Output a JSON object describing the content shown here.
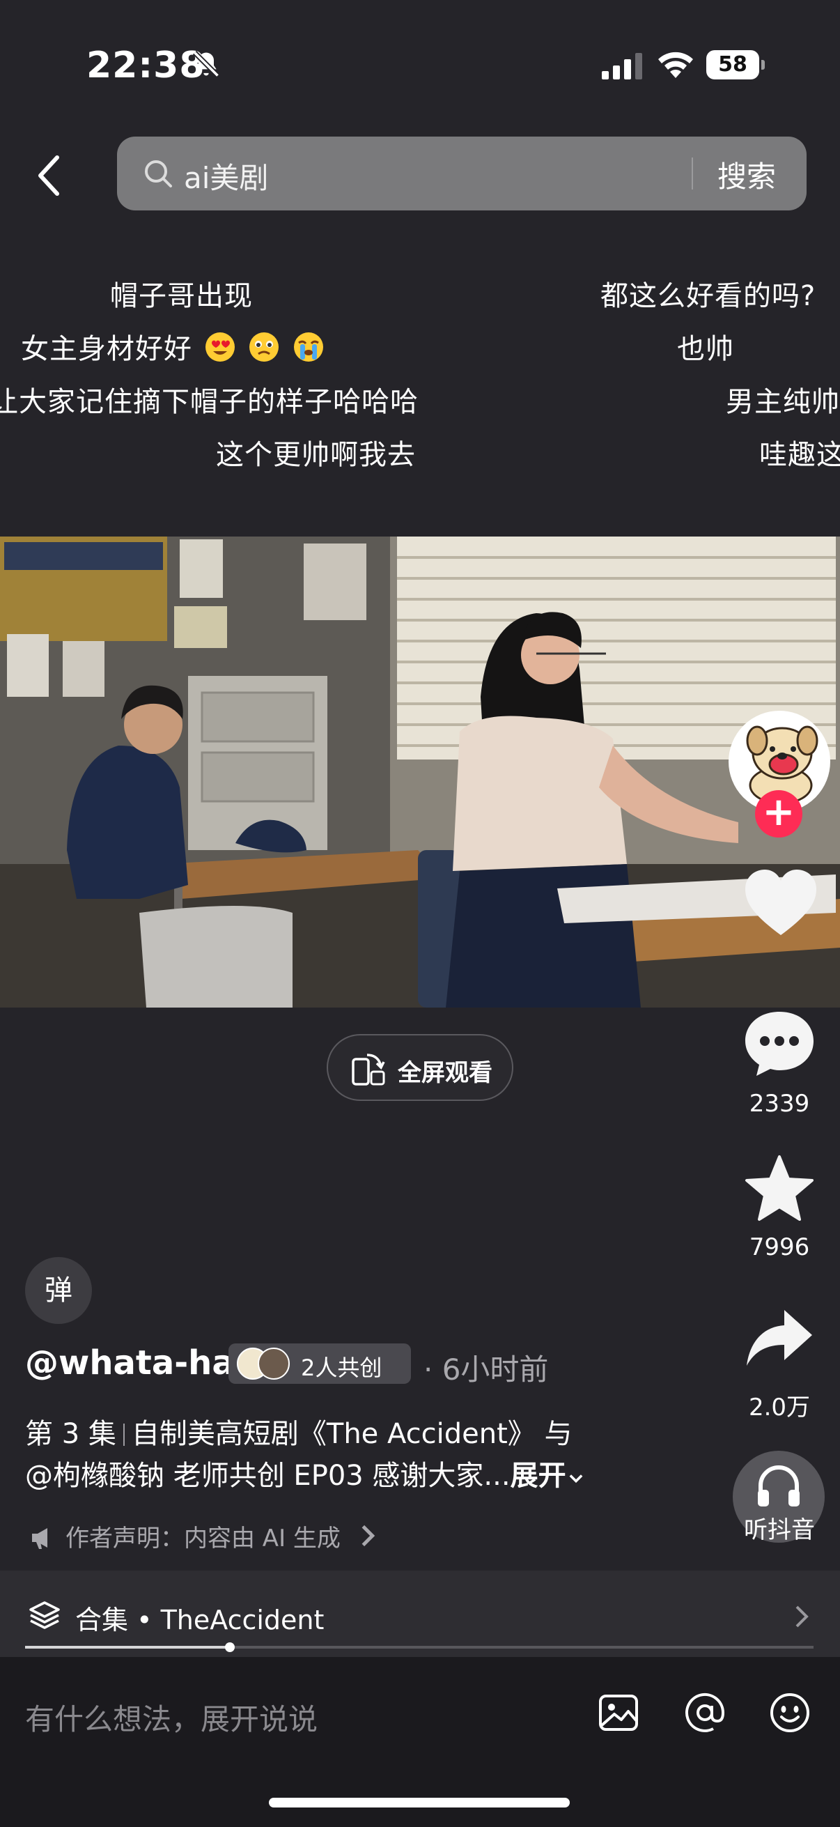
{
  "status_bar": {
    "time": "22:38",
    "battery": "58"
  },
  "search": {
    "query": "ai美剧",
    "button_label": "搜索"
  },
  "danmaku": [
    {
      "text": "帽子哥出现"
    },
    {
      "text": "都这么好看的吗?"
    },
    {
      "text": "女主身材好好"
    },
    {
      "text": "也帅"
    },
    {
      "text": "让大家记住摘下帽子的样子哈哈哈"
    },
    {
      "text": "男主纯帅"
    },
    {
      "text": "这个更帅啊我去"
    },
    {
      "text": "哇趣这"
    }
  ],
  "player": {
    "fullscreen_label": "全屏观看"
  },
  "actions": {
    "comments": "2339",
    "favorites": "7996",
    "shares": "2.0万",
    "listen_label": "听抖音"
  },
  "info": {
    "danmaku_button": "弹",
    "author": "@whata-ha",
    "cocreate_label": "2人共创",
    "time_ago": "· 6小时前",
    "desc_episode": "第 3 集",
    "desc_line1": "自制美高短剧《The Accident》 与",
    "desc_line2": "@枸橼酸钠 老师共创 EP03 感谢大家...",
    "desc_more": "展开",
    "declaration": "作者声明：内容由 AI 生成"
  },
  "collection": {
    "label": "合集 • TheAccident",
    "progress": 0.26
  },
  "comment_bar": {
    "placeholder": "有什么想法，展开说说"
  },
  "colors": {
    "accent": "#fe2c55",
    "background": "#252429"
  }
}
